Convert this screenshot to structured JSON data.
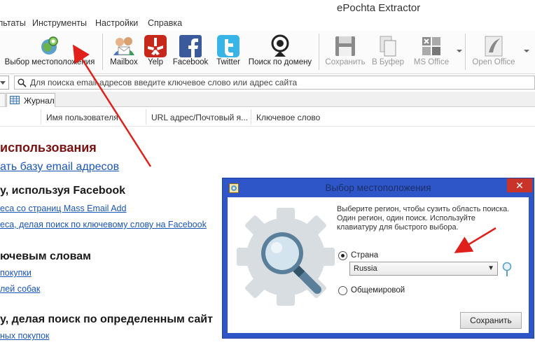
{
  "window": {
    "title": "ePochta Extractor"
  },
  "menu": [
    "льтаты",
    "Инструменты",
    "Настройки",
    "Справка"
  ],
  "ribbon": {
    "location": "Выбор местоположения",
    "mailbox": "Mailbox",
    "yelp": "Yelp",
    "facebook": "Facebook",
    "twitter": "Twitter",
    "domain_search": "Поиск по домену",
    "save": "Сохранить",
    "to_buffer": "В Буфер",
    "ms_office": "MS Office",
    "open_office": "Open Office"
  },
  "search": {
    "placeholder": "Для поиска email-адресов введите ключевое слово или адрес сайта"
  },
  "tabs": {
    "journal": "Журнал"
  },
  "columns": [
    "Имя пользователя",
    "URL адрес/Почтовый я...",
    "Ключевое слово"
  ],
  "content": {
    "title": "использования",
    "subtitle_link": "ать базу email адресов",
    "section1": {
      "heading": "у, используя Facebook",
      "links": [
        "еса со страниц Mass Email Add",
        "еса, делая поиск по ключевому слову на Facebook"
      ]
    },
    "section2": {
      "heading": "ючевым словам",
      "links": [
        "покупки",
        "лей собак"
      ]
    },
    "section3": {
      "heading": "у, делая поиск по определенным сайт",
      "links": [
        "ных покупок"
      ]
    }
  },
  "dialog": {
    "title": "Выбор местоположения",
    "close": "✕",
    "description": "Выберите регион, чтобы сузить область поиска. Один регион, один поиск. Используйте клавиатуру для быстрого выбора.",
    "option_country": "Страна",
    "country_value": "Russia",
    "option_worldwide": "Общемировой",
    "save_button": "Сохранить"
  },
  "colors": {
    "dialog_frame": "#2f56c8",
    "close_button": "#c8342a",
    "heading_red": "#7a1010",
    "link_blue": "#1a55b8",
    "annotation_arrow": "#e0201a"
  }
}
